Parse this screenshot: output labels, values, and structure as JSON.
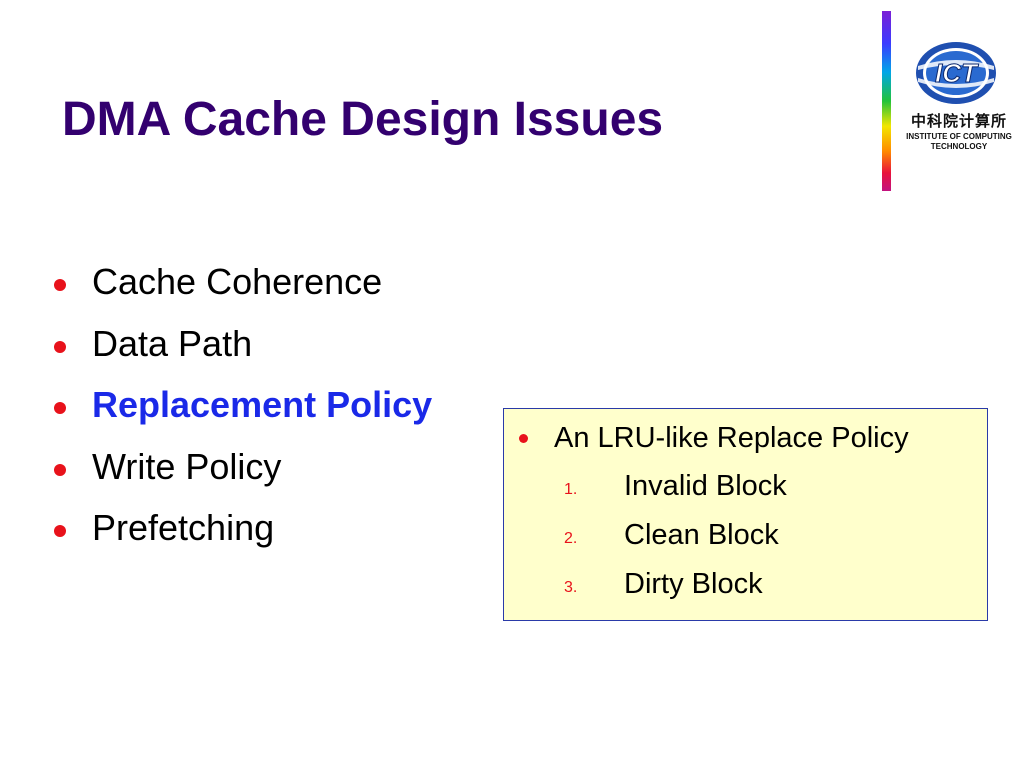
{
  "title": "DMA Cache Design Issues",
  "logo": {
    "emblem_text": "ICT",
    "chinese_name": "中科院计算所",
    "english_line1": "INSTITUTE OF COMPUTING",
    "english_line2": "TECHNOLOGY"
  },
  "bullets": [
    {
      "text": "Cache Coherence"
    },
    {
      "text": "Data Path"
    },
    {
      "text": "Replacement Policy"
    },
    {
      "text": "Write Policy"
    },
    {
      "text": "Prefetching"
    }
  ],
  "callout": {
    "heading": "An LRU-like Replace Policy",
    "items": [
      {
        "num": "1.",
        "text": "Invalid Block"
      },
      {
        "num": "2.",
        "text": "Clean Block"
      },
      {
        "num": "3.",
        "text": "Dirty Block"
      }
    ]
  },
  "colors": {
    "title": "#33006f",
    "bullet": "#e8121b",
    "highlight": "#1a29e8",
    "callout_bg": "#ffffcc",
    "callout_border": "#2a3aa8"
  }
}
